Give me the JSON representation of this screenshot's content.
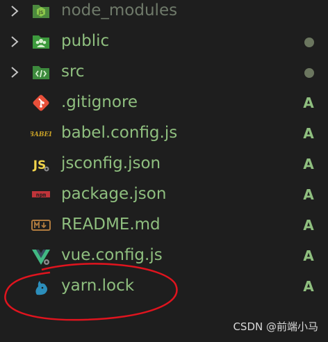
{
  "explorer": {
    "items": [
      {
        "label": "node_modules",
        "icon": "node-folder-icon",
        "expandable": true,
        "status": "",
        "dim": true
      },
      {
        "label": "public",
        "icon": "public-folder-icon",
        "expandable": true,
        "status": "dot"
      },
      {
        "label": "src",
        "icon": "src-folder-icon",
        "expandable": true,
        "status": "dot"
      },
      {
        "label": ".gitignore",
        "icon": "git-icon",
        "expandable": false,
        "status": "A"
      },
      {
        "label": "babel.config.js",
        "icon": "babel-icon",
        "expandable": false,
        "status": "A"
      },
      {
        "label": "jsconfig.json",
        "icon": "js-icon",
        "expandable": false,
        "status": "A"
      },
      {
        "label": "package.json",
        "icon": "npm-icon",
        "expandable": false,
        "status": "A"
      },
      {
        "label": "README.md",
        "icon": "markdown-icon",
        "expandable": false,
        "status": "A"
      },
      {
        "label": "vue.config.js",
        "icon": "vue-icon",
        "expandable": false,
        "status": "A"
      },
      {
        "label": "yarn.lock",
        "icon": "yarn-icon",
        "expandable": false,
        "status": "A"
      }
    ]
  },
  "watermark": "CSDN @前端小马",
  "colors": {
    "background": "#1e1e1e",
    "added_text": "#8fbf7f",
    "annotation_red": "#e0141e"
  }
}
